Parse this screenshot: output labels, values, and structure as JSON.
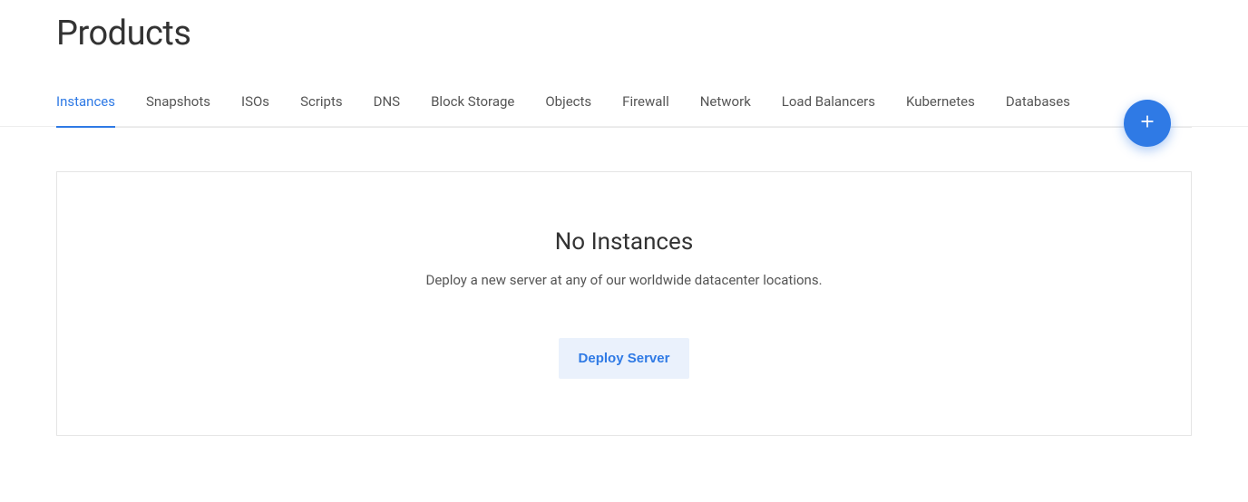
{
  "page": {
    "title": "Products"
  },
  "tabs": {
    "items": [
      {
        "label": "Instances"
      },
      {
        "label": "Snapshots"
      },
      {
        "label": "ISOs"
      },
      {
        "label": "Scripts"
      },
      {
        "label": "DNS"
      },
      {
        "label": "Block Storage"
      },
      {
        "label": "Objects"
      },
      {
        "label": "Firewall"
      },
      {
        "label": "Network"
      },
      {
        "label": "Load Balancers"
      },
      {
        "label": "Kubernetes"
      },
      {
        "label": "Databases"
      }
    ],
    "active_index": 0
  },
  "empty_state": {
    "title": "No Instances",
    "subtitle": "Deploy a new server at any of our worldwide datacenter locations.",
    "button_label": "Deploy Server"
  },
  "colors": {
    "accent": "#2f7ae5",
    "text": "#333333",
    "muted": "#555555",
    "border": "#e5e5e5"
  }
}
